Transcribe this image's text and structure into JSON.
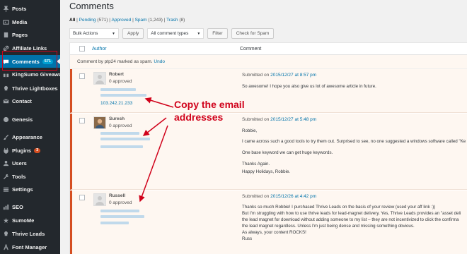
{
  "sidebar": {
    "items": [
      {
        "label": "Posts",
        "icon": "pin-icon"
      },
      {
        "label": "Media",
        "icon": "media-icon"
      },
      {
        "label": "Pages",
        "icon": "page-icon"
      },
      {
        "label": "Affiliate Links",
        "icon": "link-icon"
      },
      {
        "label": "Comments",
        "icon": "comment-icon",
        "badge": "571",
        "active": true
      },
      {
        "label": "KingSumo Giveaways",
        "icon": "gift-icon"
      },
      {
        "label": "Thrive Lightboxes",
        "icon": "lightbox-icon"
      },
      {
        "label": "Contact",
        "icon": "mail-icon"
      },
      {
        "label": "Genesis",
        "icon": "genesis-icon"
      },
      {
        "label": "Appearance",
        "icon": "brush-icon"
      },
      {
        "label": "Plugins",
        "icon": "plug-icon",
        "badge": "3"
      },
      {
        "label": "Users",
        "icon": "user-icon"
      },
      {
        "label": "Tools",
        "icon": "wrench-icon"
      },
      {
        "label": "Settings",
        "icon": "settings-icon"
      },
      {
        "label": "SEO",
        "icon": "seo-icon"
      },
      {
        "label": "SumoMe",
        "icon": "sumome-icon"
      },
      {
        "label": "Thrive Leads",
        "icon": "leads-icon"
      },
      {
        "label": "Font Manager",
        "icon": "font-icon"
      }
    ]
  },
  "page": {
    "title": "Comments",
    "filters": {
      "all": "All",
      "pending": "Pending",
      "pending_count": "(571)",
      "approved": "Approved",
      "spam": "Spam",
      "spam_count": "(1,243)",
      "trash": "Trash",
      "trash_count": "(8)"
    },
    "toolbar": {
      "bulk_actions": "Bulk Actions",
      "apply": "Apply",
      "comment_types": "All comment types",
      "filter": "Filter",
      "check_spam": "Check for Spam"
    },
    "table": {
      "col_author": "Author",
      "col_comment": "Comment",
      "notice_text": "Comment by ptp24 marked as spam.",
      "undo": "Undo"
    },
    "comments": [
      {
        "author": "Robert",
        "approved": "0 approved",
        "ip": "103.242.21.233",
        "submitted_on": "Submitted on",
        "date": "2015/12/27 at 8:57 pm",
        "lines": [
          "So awesome! I hope you also give us lot of awesome article in future."
        ]
      },
      {
        "author": "Suresh",
        "approved": "0 approved",
        "submitted_on": "Submitted on",
        "date": "2015/12/27 at 5:48 pm",
        "lines": [
          "Robbie,",
          "I came across such a good tools to try them out. Surprised to see, no one suggested a windows software called \"Ke",
          "One base keyword we can get huge keywords.",
          "Thanks Again.",
          "Happy Holidays, Robbie."
        ]
      },
      {
        "author": "Russell",
        "approved": "0 approved",
        "submitted_on": "Submitted on",
        "date": "2015/12/26 at 4:42 pm",
        "lines": [
          "Thanks so much Robbie! I purchased Thrive Leads on the basis of your review (used your aff link :))",
          "But I'm struggling with how to use thrive leads for lead-magnet delivery. Yes, Thrive Leads provides an \"asset deli",
          "the lead magnet for download without adding someone to my list – they are not incentivized to click the confirma",
          "the lead magnet regardless. Unless I'm just being dense and missing something obvious.",
          "As always, your content ROCKS!",
          "Russ"
        ]
      }
    ]
  },
  "annotation": {
    "line1": "Copy the email",
    "line2": "addresses",
    "color": "#d0021b"
  }
}
